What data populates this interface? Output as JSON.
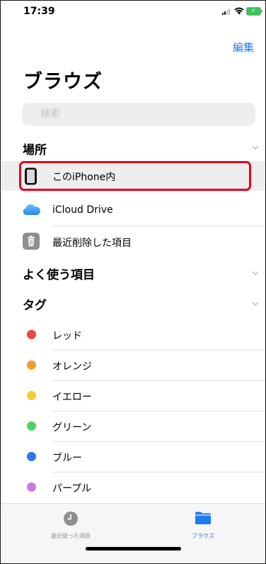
{
  "status": {
    "time": "17:39"
  },
  "header": {
    "edit_label": "編集",
    "title": "ブラウズ"
  },
  "search": {
    "placeholder": "検索"
  },
  "locations": {
    "title": "場所",
    "items": [
      {
        "label": "このiPhone内",
        "icon": "iphone-icon",
        "selected": true
      },
      {
        "label": "iCloud Drive",
        "icon": "icloud-icon"
      },
      {
        "label": "最近削除した項目",
        "icon": "trash-icon"
      }
    ]
  },
  "favorites": {
    "title": "よく使う項目"
  },
  "tags": {
    "title": "タグ",
    "items": [
      {
        "label": "レッド",
        "color": "#f0473c"
      },
      {
        "label": "オレンジ",
        "color": "#f59a2f"
      },
      {
        "label": "イエロー",
        "color": "#f7cc2c"
      },
      {
        "label": "グリーン",
        "color": "#4cd365"
      },
      {
        "label": "ブルー",
        "color": "#2c78f0"
      },
      {
        "label": "パープル",
        "color": "#c67ae0"
      }
    ]
  },
  "tabbar": {
    "recents_label": "最近使った項目",
    "browse_label": "ブラウズ"
  },
  "colors": {
    "accent": "#1e7cf2",
    "highlight": "#e5001c"
  }
}
